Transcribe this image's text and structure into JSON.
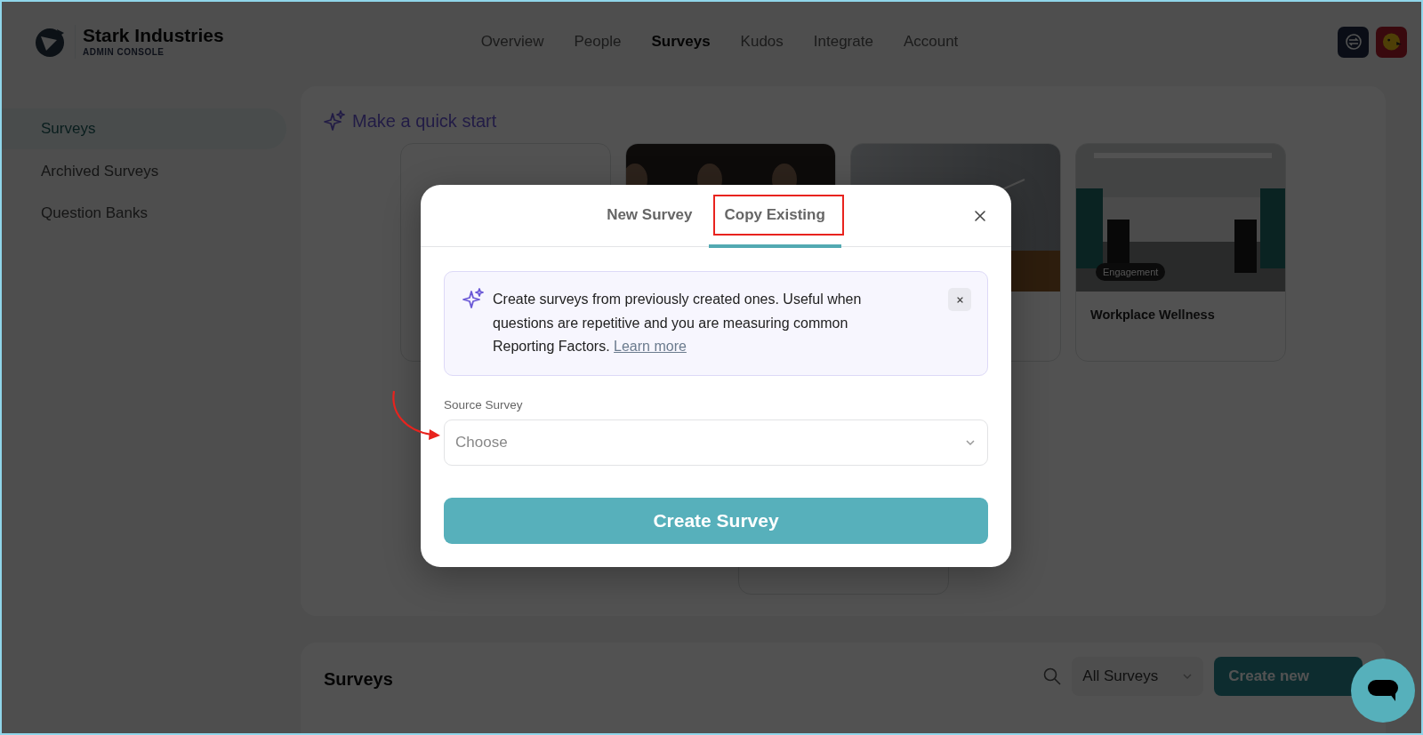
{
  "header": {
    "org_name": "Stark Industries",
    "org_subtitle": "ADMIN CONSOLE",
    "nav": [
      {
        "label": "Overview",
        "selected": false
      },
      {
        "label": "People",
        "selected": false
      },
      {
        "label": "Surveys",
        "selected": true
      },
      {
        "label": "Kudos",
        "selected": false
      },
      {
        "label": "Integrate",
        "selected": false
      },
      {
        "label": "Account",
        "selected": false
      }
    ]
  },
  "sidebar": {
    "items": [
      {
        "label": "Surveys",
        "selected": true
      },
      {
        "label": "Archived Surveys",
        "selected": false
      },
      {
        "label": "Question Banks",
        "selected": false
      }
    ]
  },
  "quick_start": {
    "title": "Make a quick start",
    "cards": [
      {
        "kind": "blank"
      },
      {
        "kind": "picture"
      },
      {
        "kind": "picture"
      },
      {
        "kind": "picture",
        "badge": "Engagement",
        "title": "Workplace Wellness"
      },
      {
        "kind": "blank"
      }
    ]
  },
  "surveys_panel": {
    "title": "Surveys",
    "filter": "All Surveys",
    "create_button": "Create new"
  },
  "modal": {
    "tabs": [
      {
        "label": "New Survey",
        "selected": false,
        "highlighted": false
      },
      {
        "label": "Copy Existing",
        "selected": true,
        "highlighted": true
      }
    ],
    "info": {
      "text": "Create surveys from previously created ones. Useful when questions are repetitive and you are measuring common Reporting Factors.",
      "link": "Learn more"
    },
    "source_field": {
      "label": "Source Survey",
      "placeholder": "Choose",
      "annotated": true
    },
    "submit": "Create Survey"
  }
}
